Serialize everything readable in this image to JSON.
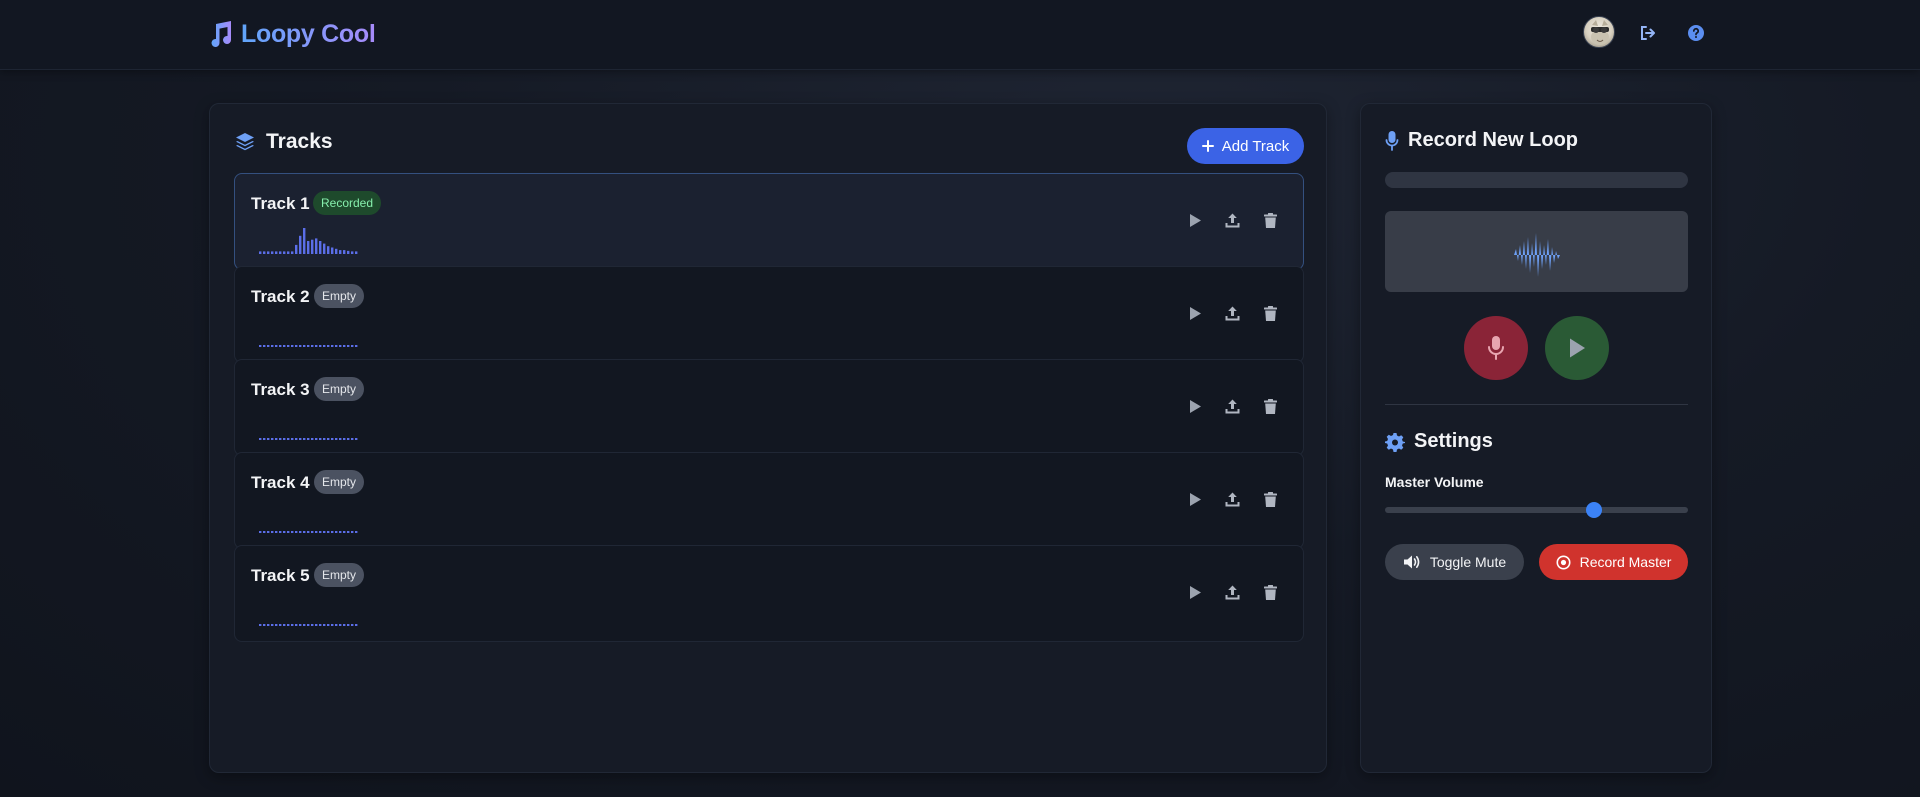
{
  "header": {
    "brand": "Loopy Cool",
    "icons": [
      "music-note-icon",
      "avatar",
      "logout-icon",
      "help-icon"
    ]
  },
  "tracks_panel": {
    "title": "Tracks",
    "add_button": "Add Track",
    "tracks": [
      {
        "name": "Track 1",
        "status": "Recorded",
        "active": true
      },
      {
        "name": "Track 2",
        "status": "Empty",
        "active": false
      },
      {
        "name": "Track 3",
        "status": "Empty",
        "active": false
      },
      {
        "name": "Track 4",
        "status": "Empty",
        "active": false
      },
      {
        "name": "Track 5",
        "status": "Empty",
        "active": false
      }
    ],
    "track1_wave_levels": [
      0.1,
      0.1,
      0.1,
      0.1,
      0.1,
      0.1,
      0.1,
      0.1,
      0.1,
      0.35,
      0.7,
      1.0,
      0.5,
      0.55,
      0.6,
      0.5,
      0.4,
      0.3,
      0.25,
      0.2,
      0.15,
      0.15,
      0.12,
      0.1,
      0.1
    ]
  },
  "record_panel": {
    "title": "Record New Loop",
    "progress": 0,
    "settings_title": "Settings",
    "volume_label": "Master Volume",
    "volume": 0.69,
    "mute_button": "Toggle Mute",
    "master_button": "Record Master"
  },
  "colors": {
    "accent": "#3b63e6",
    "recorded_badge": "#1e4a2c",
    "record_master": "#d0332d",
    "mic_button": "#8a2437",
    "play_button": "#2a5a35"
  }
}
